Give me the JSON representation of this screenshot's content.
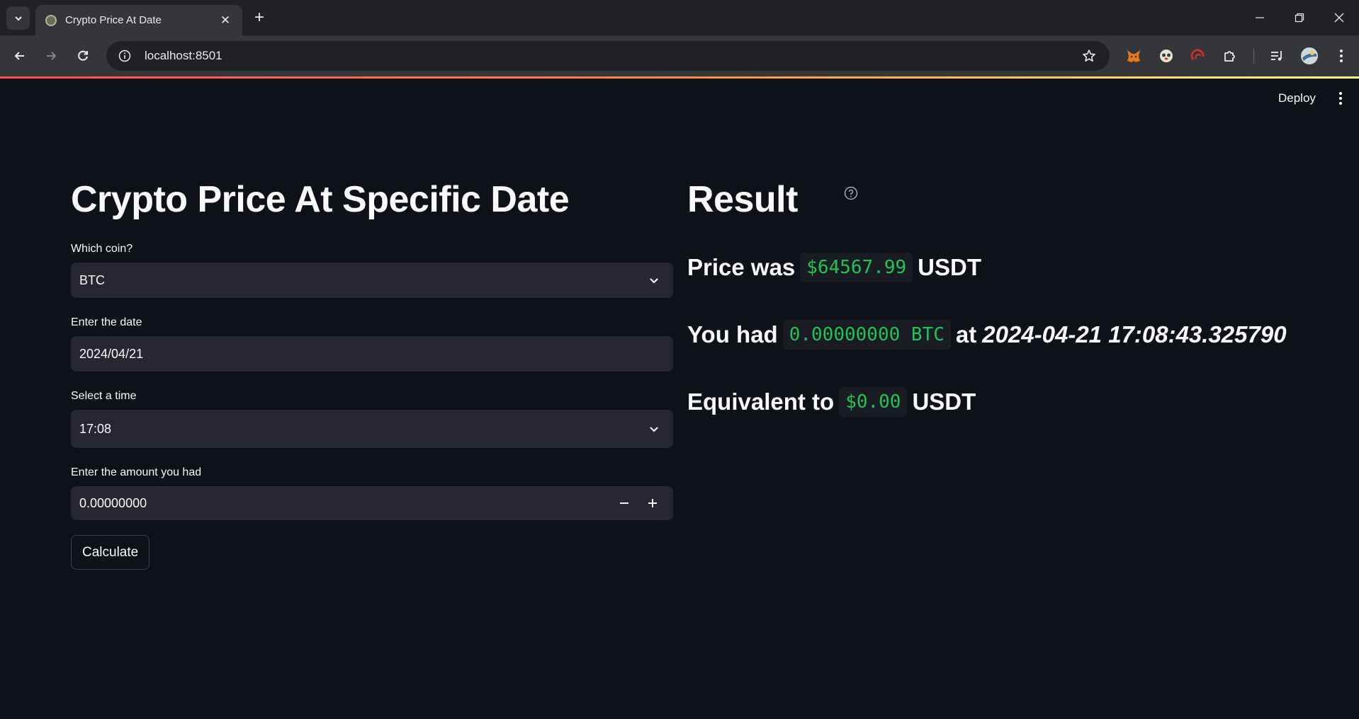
{
  "browser": {
    "tab_title": "Crypto Price At Date",
    "url": "localhost:8501"
  },
  "colors": {
    "page_bg": "#0e1117",
    "field_bg": "#262730",
    "code_green": "#21c354",
    "accent_gradient": [
      "#ff4b4b",
      "#ff8a3d",
      "#fffd80"
    ]
  },
  "header": {
    "deploy_label": "Deploy"
  },
  "form": {
    "title": "Crypto Price At Specific Date",
    "coin_label": "Which coin?",
    "coin_value": "BTC",
    "date_label": "Enter the date",
    "date_value": "2024/04/21",
    "time_label": "Select a time",
    "time_value": "17:08",
    "amount_label": "Enter the amount you had",
    "amount_value": "0.00000000",
    "calculate_label": "Calculate"
  },
  "result": {
    "title": "Result",
    "price_prefix": "Price was",
    "price_value": "$64567.99",
    "price_suffix": "USDT",
    "had_prefix": "You had",
    "had_value": "0.00000000 BTC",
    "had_at": "at",
    "had_timestamp": "2024-04-21 17:08:43.325790",
    "equiv_prefix": "Equivalent to",
    "equiv_value": "$0.00",
    "equiv_suffix": "USDT"
  }
}
